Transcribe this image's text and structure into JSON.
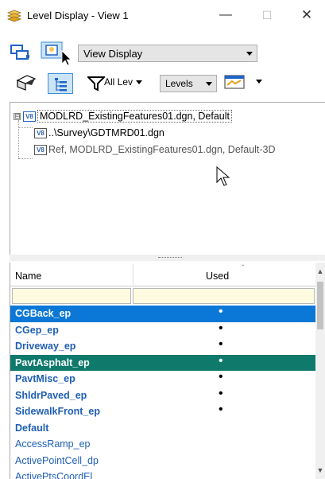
{
  "window": {
    "title": "Level Display - View 1",
    "minimize": "—",
    "maximize": "☐",
    "close": "✕"
  },
  "toolbar": {
    "display_mode": "View Display",
    "filter_label": "All Lev",
    "levels_label": "Levels"
  },
  "tree": {
    "root": {
      "expander": "⊟",
      "badge": "V8",
      "label": "MODLRD_ExistingFeatures01.dgn, Default"
    },
    "children": [
      {
        "badge": "V8",
        "label": "..\\Survey\\GDTMRD01.dgn"
      },
      {
        "badge": "V8",
        "label": "Ref, MODLRD_ExistingFeatures01.dgn, Default-3D"
      }
    ]
  },
  "grid": {
    "columns": {
      "name": "Name",
      "used": "Used",
      "sort_icon": "ˇ"
    },
    "rows": [
      {
        "name": "CGBack_ep",
        "used": "•",
        "style": "bold",
        "selected": "blue"
      },
      {
        "name": "CGep_ep",
        "used": "•",
        "style": "bold",
        "selected": ""
      },
      {
        "name": "Driveway_ep",
        "used": "•",
        "style": "bold",
        "selected": ""
      },
      {
        "name": "PavtAsphalt_ep",
        "used": "•",
        "style": "bold",
        "selected": "teal"
      },
      {
        "name": "PavtMisc_ep",
        "used": "•",
        "style": "bold",
        "selected": ""
      },
      {
        "name": "ShldrPaved_ep",
        "used": "•",
        "style": "bold",
        "selected": ""
      },
      {
        "name": "SidewalkFront_ep",
        "used": "•",
        "style": "bold",
        "selected": ""
      },
      {
        "name": "Default",
        "used": "",
        "style": "bold",
        "selected": ""
      },
      {
        "name": "AccessRamp_ep",
        "used": "",
        "style": "normal",
        "selected": ""
      },
      {
        "name": "ActivePointCell_dp",
        "used": "",
        "style": "normal",
        "selected": ""
      },
      {
        "name": "ActivePtsCoordEl",
        "used": "",
        "style": "normal",
        "selected": ""
      }
    ]
  },
  "scrollbar": {
    "up": "▲",
    "down": "▼"
  },
  "colors": {
    "selection_blue": "#0b78d7",
    "selection_teal": "#0f7a6c",
    "level_text": "#1f5fb4",
    "filter_row_bg": "#fffbe0"
  }
}
